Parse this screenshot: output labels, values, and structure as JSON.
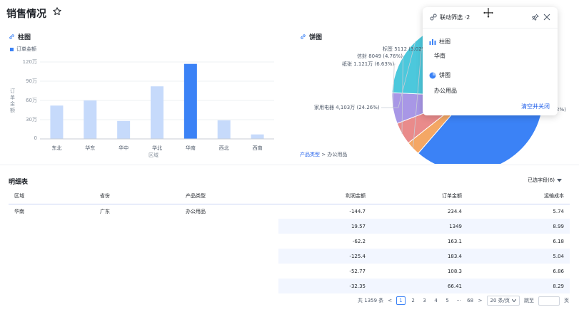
{
  "page": {
    "title": "销售情况"
  },
  "bar_section": {
    "title": "柱图",
    "legend": "订单金额",
    "y_axis_label": "订单金额",
    "x_axis_label": "区域"
  },
  "pie_section": {
    "title": "饼图"
  },
  "breadcrumb": {
    "link": "产品类型",
    "separator": ">",
    "current": "办公用品"
  },
  "chart_data": [
    {
      "type": "bar",
      "categories": [
        "东北",
        "华东",
        "华中",
        "华北",
        "华南",
        "西北",
        "西南"
      ],
      "series": [
        {
          "name": "订单金额",
          "values": [
            520000,
            600000,
            280000,
            820000,
            1170000,
            290000,
            70000
          ]
        }
      ],
      "ylabel": "订单金额",
      "xlabel": "区域",
      "ylim": [
        0,
        1200000
      ],
      "yticks": [
        "0",
        "30万",
        "60万",
        "90万",
        "120万"
      ],
      "highlight": "华南",
      "colors": {
        "normal": "#c6dafb",
        "highlight": "#3b82f6"
      }
    },
    {
      "type": "pie",
      "slices": [
        {
          "label": "标签 5112 (3.02%)",
          "value": 3.02,
          "color": "#f4a765"
        },
        {
          "label": "信封 8049 (4.76%)",
          "value": 4.76,
          "color": "#e98b8b"
        },
        {
          "label": "纸张 1.121万 (6.63%)",
          "value": 6.63,
          "color": "#a897e6"
        },
        {
          "label": "家用电器 4,103万 (24.26%)",
          "value": 24.26,
          "color": "#4cc8dc"
        },
        {
          "label": "",
          "value": 61.33,
          "color": "#3b82f6"
        }
      ],
      "partial_label": "2%)"
    }
  ],
  "detail": {
    "title": "明细表",
    "fields_button": "已选字段(6)",
    "columns": [
      "区域",
      "省份",
      "产品类型",
      "利润金额",
      "订单金额",
      "运输成本"
    ],
    "rows": [
      [
        "华南",
        "广东",
        "办公用品",
        "-144.7",
        "234.4",
        "5.74"
      ],
      [
        "",
        "",
        "",
        "19.57",
        "1349",
        "8.99"
      ],
      [
        "",
        "",
        "",
        "-62.2",
        "163.1",
        "6.18"
      ],
      [
        "",
        "",
        "",
        "-125.4",
        "183.4",
        "5.04"
      ],
      [
        "",
        "",
        "",
        "-52.77",
        "108.3",
        "6.86"
      ],
      [
        "",
        "",
        "",
        "-32.35",
        "66.41",
        "8.29"
      ]
    ]
  },
  "pagination": {
    "total": "共 1359 条",
    "prev": "<",
    "pages": [
      "1",
      "2",
      "3",
      "4",
      "5",
      "···",
      "68"
    ],
    "next": ">",
    "page_size": "20 条/页",
    "jump_label": "跳至",
    "page_suffix": "页"
  },
  "filter_popup": {
    "title": "联动筛选 ·2",
    "sections": [
      {
        "name": "柱图",
        "value": "华南",
        "icon": "bar-chart-icon"
      },
      {
        "name": "饼图",
        "value": "办公用品",
        "icon": "pie-chart-icon"
      }
    ],
    "clear_button": "清空并关闭"
  }
}
